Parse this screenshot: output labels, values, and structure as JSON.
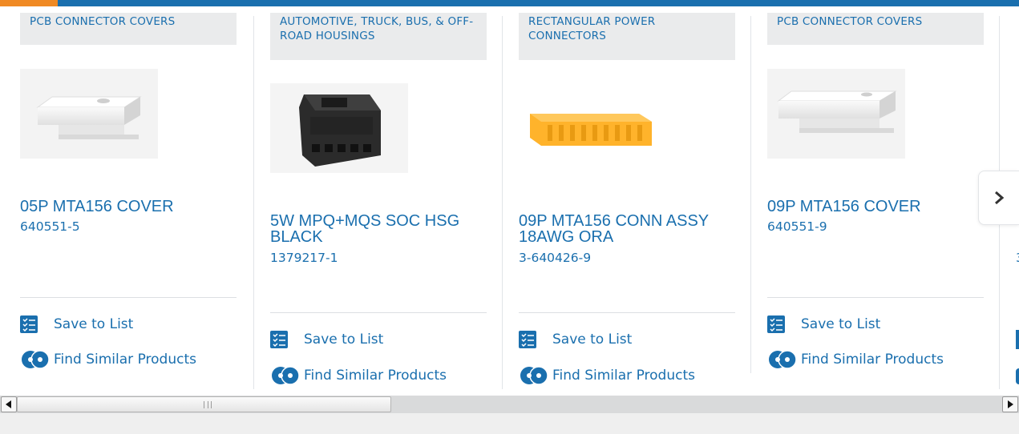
{
  "carousel": {
    "cards": [
      {
        "category": "PCB CONNECTOR COVERS",
        "title": "05P MTA156 COVER",
        "part_number": "640551-5",
        "image": "white-cover-image",
        "save_label": "Save to List",
        "similar_label": "Find Similar Products"
      },
      {
        "category": "AUTOMOTIVE, TRUCK, BUS, & OFF-ROAD HOUSINGS",
        "title": "5W MPQ+MQS SOC HSG BLACK",
        "part_number": "1379217-1",
        "image": "black-housing-image",
        "save_label": "Save to List",
        "similar_label": "Find Similar Products"
      },
      {
        "category": "RECTANGULAR POWER CONNECTORS",
        "title": "09P MTA156 CONN ASSY 18AWG ORA",
        "part_number": "3-640426-9",
        "image": "orange-connector-image",
        "save_label": "Save to List",
        "similar_label": "Find Similar Products"
      },
      {
        "category": "PCB CONNECTOR COVERS",
        "title": "09P MTA156 COVER",
        "part_number": "640551-9",
        "image": "white-cover-image",
        "save_label": "Save to List",
        "similar_label": "Find Similar Products"
      },
      {
        "category": "",
        "title": "",
        "part_number": "3",
        "save_label": "",
        "similar_label": ""
      }
    ],
    "next_button_icon": "chevron-right-icon"
  },
  "colors": {
    "brand_blue": "#1a6fae",
    "active_orange": "#f08a24",
    "category_bg": "#eaebec",
    "connector_orange": "#ffb32b"
  },
  "scrollbar": {
    "left_arrow_icon": "triangle-left-icon",
    "right_arrow_icon": "triangle-right-icon",
    "grip_icon": "grip-icon"
  }
}
